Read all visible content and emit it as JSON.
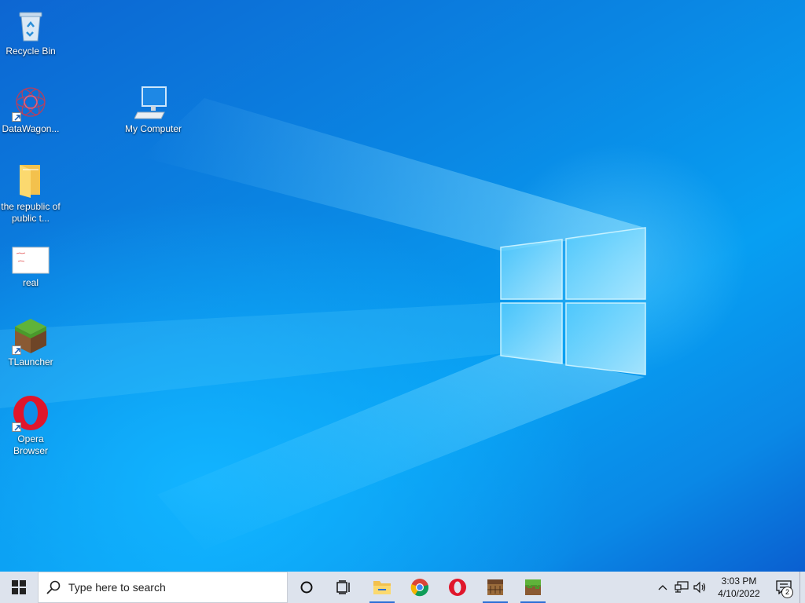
{
  "desktop": {
    "icons": [
      {
        "label": "Recycle Bin",
        "icon": "recycle-bin-icon"
      },
      {
        "label": "DataWagon...",
        "icon": "datawagon-icon"
      },
      {
        "label": "My Computer",
        "icon": "computer-icon"
      },
      {
        "label": "the republic of public t...",
        "icon": "folder-icon"
      },
      {
        "label": "real",
        "icon": "image-file-icon"
      },
      {
        "label": "TLauncher",
        "icon": "tlauncher-icon"
      },
      {
        "label": "Opera Browser",
        "icon": "opera-icon"
      }
    ]
  },
  "taskbar": {
    "search_placeholder": "Type here to search",
    "pinned": [
      {
        "name": "file-explorer-icon",
        "running": true
      },
      {
        "name": "chrome-icon",
        "running": false
      },
      {
        "name": "opera-icon",
        "running": false
      },
      {
        "name": "crafting-table-icon",
        "running": true
      },
      {
        "name": "tlauncher-icon",
        "running": true
      }
    ],
    "clock": {
      "time": "3:03 PM",
      "date": "4/10/2022"
    },
    "notification_count": "2"
  },
  "colors": {
    "taskbar_bg": "#dde3ed",
    "accent": "#2b6fd6",
    "wallpaper": "#0a86e3"
  }
}
